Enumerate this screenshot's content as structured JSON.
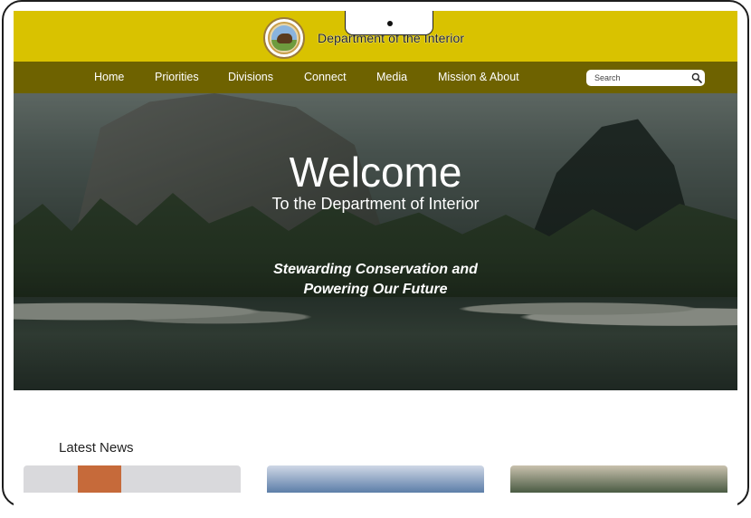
{
  "header": {
    "department_title": "Department of the Interior",
    "seal_icon": "bison-seal-icon",
    "topbar_color": "#d9c200"
  },
  "nav": {
    "items": [
      {
        "label": "Home"
      },
      {
        "label": "Priorities"
      },
      {
        "label": "Divisions"
      },
      {
        "label": "Connect"
      },
      {
        "label": "Media"
      },
      {
        "label": "Mission & About"
      }
    ],
    "bar_color": "#6e6200"
  },
  "search": {
    "placeholder": "Search",
    "value": "",
    "icon": "magnifier-icon"
  },
  "hero": {
    "title": "Welcome",
    "subtitle": "To the Department of Interior",
    "tagline": "Stewarding Conservation and Powering Our Future"
  },
  "news": {
    "heading": "Latest News",
    "cards": [
      {
        "image_colors": [
          "#d9d9dc",
          "#c66a3a"
        ]
      },
      {
        "image_colors": [
          "#cfd7e6",
          "#5c7ea8"
        ]
      },
      {
        "image_colors": [
          "#c9c1ae",
          "#4a5b43"
        ]
      }
    ]
  }
}
